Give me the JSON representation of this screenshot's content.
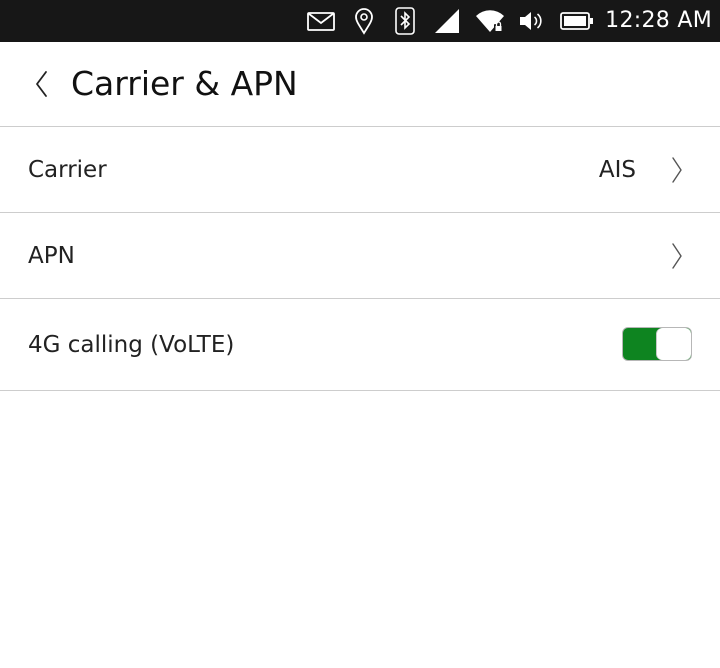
{
  "status_bar": {
    "time": "12:28 AM",
    "icons": [
      "message-icon",
      "location-icon",
      "bluetooth-icon",
      "cellular-signal-icon",
      "wifi-secured-icon",
      "volume-icon",
      "battery-icon"
    ]
  },
  "header": {
    "title": "Carrier & APN",
    "back_icon": "chevron-left-icon"
  },
  "settings": {
    "carrier": {
      "label": "Carrier",
      "value": "AIS"
    },
    "apn": {
      "label": "APN"
    },
    "volte": {
      "label": "4G calling (VoLTE)",
      "enabled": true
    }
  },
  "colors": {
    "status_bar": "#171717",
    "toggle_on": "#0e8420",
    "divider": "#cdcdcd"
  }
}
